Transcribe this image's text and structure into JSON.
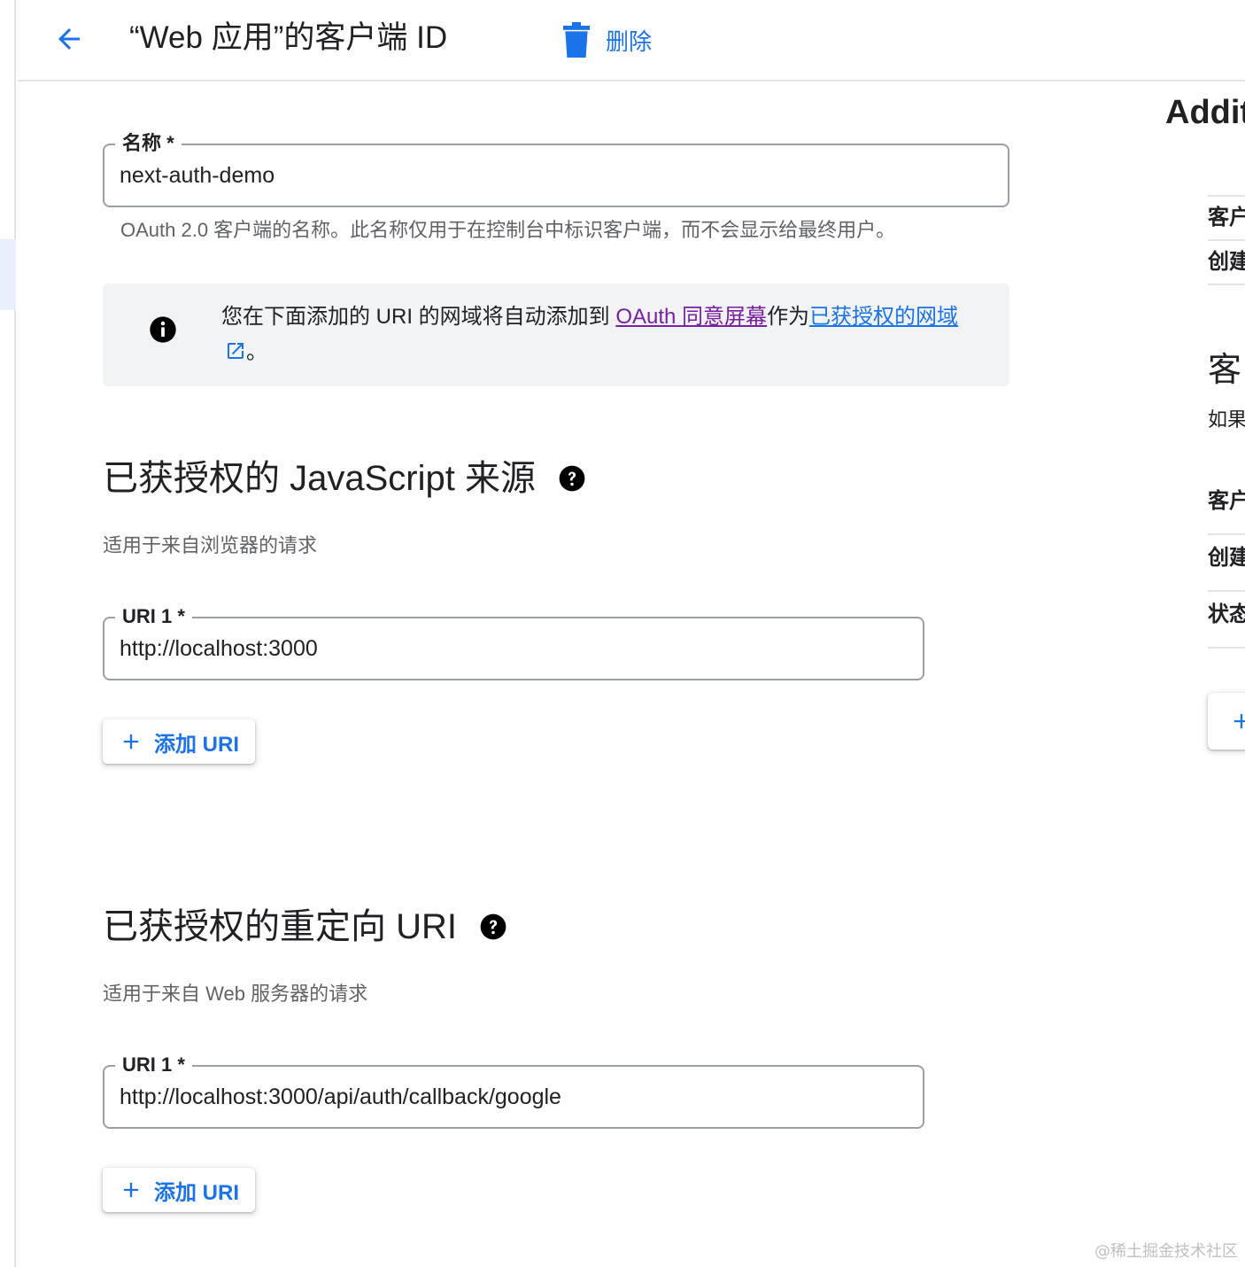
{
  "header": {
    "title": "“Web 应用”的客户端 ID",
    "delete_label": "删除"
  },
  "name_field": {
    "label": "名称 *",
    "value": "next-auth-demo",
    "hint": "OAuth 2.0 客户端的名称。此名称仅用于在控制台中标识客户端，而不会显示给最终用户。"
  },
  "info_box": {
    "text_before": "您在下面添加的 URI 的网域将自动添加到 ",
    "link1": "OAuth 同意屏幕",
    "text_mid": "作为",
    "link2": "已获授权的网域",
    "text_after": "。"
  },
  "js_origins": {
    "title": "已获授权的 JavaScript 来源",
    "description": "适用于来自浏览器的请求",
    "uri_label": "URI 1 *",
    "uri_value": "http://localhost:3000",
    "add_label": "添加 URI"
  },
  "redirect_uris": {
    "title": "已获授权的重定向 URI",
    "description": "适用于来自 Web 服务器的请求",
    "uri_label": "URI 1 *",
    "uri_value": "http://localhost:3000/api/auth/callback/google",
    "add_label": "添加 URI"
  },
  "right_panel": {
    "title": "Addit",
    "row1": "客户",
    "row2": "创建",
    "section": "客",
    "desc": "如果",
    "row3": "客户",
    "row4": "创建",
    "row5": "状态"
  },
  "watermark": "@稀土掘金技术社区",
  "colors": {
    "accent": "#1a73e8",
    "visited_link": "#7b1fa2",
    "info_bg": "#f1f3f4"
  }
}
